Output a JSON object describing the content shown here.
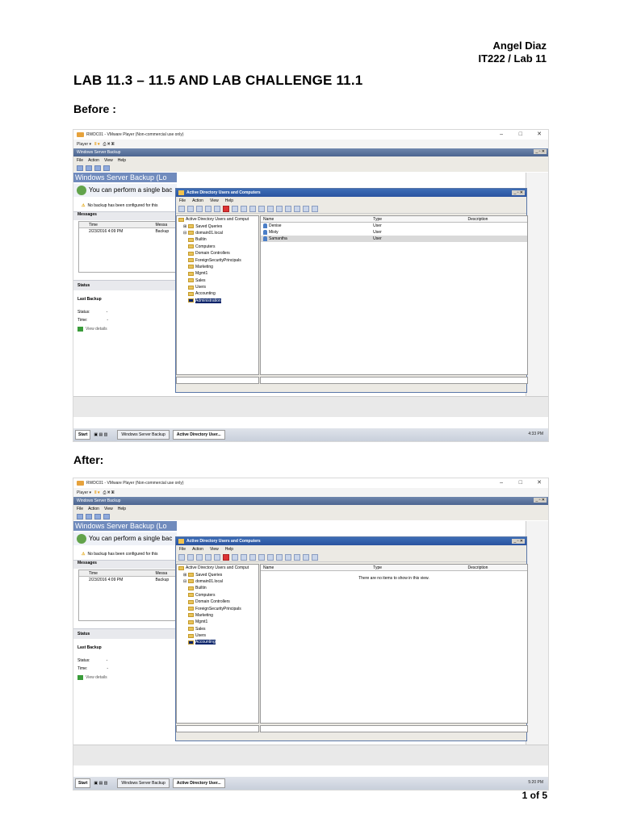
{
  "header": {
    "name": "Angel Diaz",
    "course": "IT222 / Lab 11"
  },
  "title": "LAB 11.3 – 11.5 AND LAB CHALLENGE 11.1",
  "screenshots": [
    {
      "label": "Before :",
      "vm_title": "RWDC01 - VMware Player (Non-commercial use only)",
      "player_menu": "Player ▾",
      "wsb_title": "Windows Server Backup",
      "menus": [
        "File",
        "Action",
        "View",
        "Help"
      ],
      "wsb_heading": "Windows Server Backup (Lo",
      "perform_text": "You can perform a single bac",
      "no_backup": "No backup has been configured for this",
      "messages_label": "Messages",
      "msg_cols": [
        "Time",
        "Messa"
      ],
      "msg_row": [
        "2/23/2016 4:09 PM",
        "Backup"
      ],
      "status_label": "Status",
      "last_backup": "Last Backup",
      "status_field": "Status:",
      "time_field": "Time:",
      "dash": "-",
      "view_details": "View details",
      "ad_title": "Active Directory Users and Computers",
      "tree": [
        {
          "name": "Active Directory Users and Comput",
          "indent": 0,
          "exp": ""
        },
        {
          "name": "Saved Queries",
          "indent": 1,
          "exp": "⊞"
        },
        {
          "name": "domain01.local",
          "indent": 1,
          "exp": "⊟"
        },
        {
          "name": "Builtin",
          "indent": 2,
          "exp": ""
        },
        {
          "name": "Computers",
          "indent": 2,
          "exp": ""
        },
        {
          "name": "Domain Controllers",
          "indent": 2,
          "exp": ""
        },
        {
          "name": "ForeignSecurityPrincipals",
          "indent": 2,
          "exp": ""
        },
        {
          "name": "Marketing",
          "indent": 2,
          "exp": ""
        },
        {
          "name": "Mgmt1",
          "indent": 2,
          "exp": ""
        },
        {
          "name": "Sales",
          "indent": 2,
          "exp": ""
        },
        {
          "name": "Users",
          "indent": 2,
          "exp": ""
        },
        {
          "name": "Accounting",
          "indent": 2,
          "exp": ""
        },
        {
          "name": "Administration",
          "indent": 2,
          "exp": "",
          "selected": true
        }
      ],
      "cols": [
        "Name",
        "Type",
        "Description"
      ],
      "rows": [
        {
          "name": "Denise",
          "type": "User"
        },
        {
          "name": "Misty",
          "type": "User"
        },
        {
          "name": "Samantha",
          "type": "User",
          "highlighted": true
        }
      ],
      "empty_text": "",
      "start": "Start",
      "taskbar_items": [
        "Windows Server Backup",
        "Active Directory User..."
      ],
      "clock": "4:33 PM"
    },
    {
      "label": "After:",
      "vm_title": "RWDC01 - VMware Player (Non-commercial use only)",
      "player_menu": "Player ▾",
      "wsb_title": "Windows Server Backup",
      "menus": [
        "File",
        "Action",
        "View",
        "Help"
      ],
      "wsb_heading": "Windows Server Backup (Lo",
      "perform_text": "You can perform a single bac",
      "no_backup": "No backup has been configured for this",
      "messages_label": "Messages",
      "msg_cols": [
        "Time",
        "Messa"
      ],
      "msg_row": [
        "2/23/2016 4:09 PM",
        "Backup"
      ],
      "status_label": "Status",
      "last_backup": "Last Backup",
      "status_field": "Status:",
      "time_field": "Time:",
      "dash": "-",
      "view_details": "View details",
      "ad_title": "Active Directory Users and Computers",
      "tree": [
        {
          "name": "Active Directory Users and Comput",
          "indent": 0,
          "exp": ""
        },
        {
          "name": "Saved Queries",
          "indent": 1,
          "exp": "⊞"
        },
        {
          "name": "domain01.local",
          "indent": 1,
          "exp": "⊟"
        },
        {
          "name": "Builtin",
          "indent": 2,
          "exp": ""
        },
        {
          "name": "Computers",
          "indent": 2,
          "exp": ""
        },
        {
          "name": "Domain Controllers",
          "indent": 2,
          "exp": ""
        },
        {
          "name": "ForeignSecurityPrincipals",
          "indent": 2,
          "exp": ""
        },
        {
          "name": "Marketing",
          "indent": 2,
          "exp": ""
        },
        {
          "name": "Mgmt1",
          "indent": 2,
          "exp": ""
        },
        {
          "name": "Sales",
          "indent": 2,
          "exp": ""
        },
        {
          "name": "Users",
          "indent": 2,
          "exp": ""
        },
        {
          "name": "Accounting",
          "indent": 2,
          "exp": "",
          "selected": true
        }
      ],
      "cols": [
        "Name",
        "Type",
        "Description"
      ],
      "rows": [],
      "empty_text": "There are no items to show in this view.",
      "start": "Start",
      "taskbar_items": [
        "Windows Server Backup",
        "Active Directory User..."
      ],
      "clock": "5:20 PM"
    }
  ],
  "page_number": "1 of 5"
}
